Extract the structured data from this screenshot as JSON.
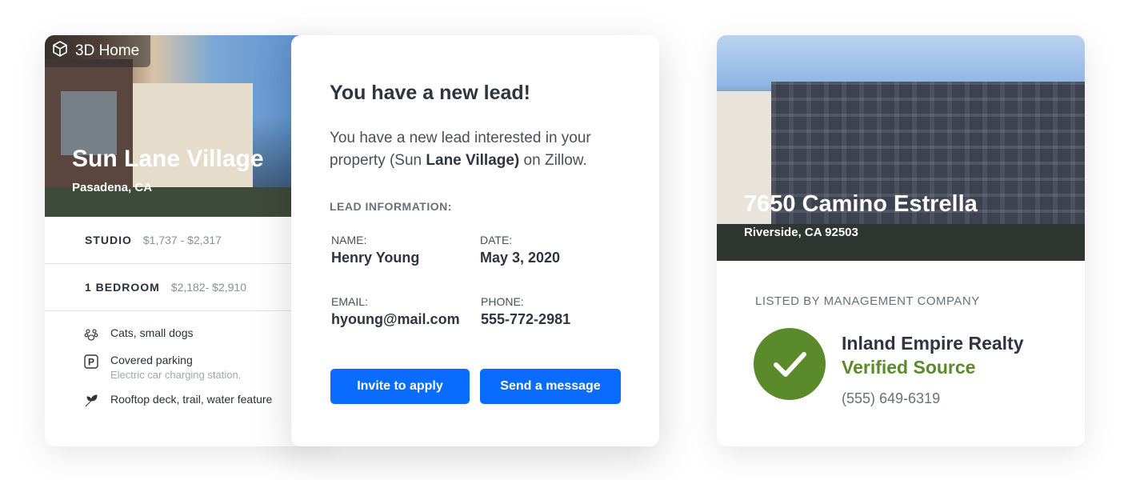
{
  "left_card": {
    "badge_label": "3D Home",
    "title": "Sun Lane Village",
    "city": "Pasadena, CA",
    "pricing": [
      {
        "label": "STUDIO",
        "value": "$1,737 - $2,317"
      },
      {
        "label": "1 BEDROOM",
        "value": "$2,182- $2,910"
      }
    ],
    "amenities": [
      {
        "icon": "paw-icon",
        "text": "Cats, small dogs",
        "sub": ""
      },
      {
        "icon": "parking-icon",
        "text": "Covered parking",
        "sub": "Electric car charging station."
      },
      {
        "icon": "leaf-icon",
        "text": "Rooftop deck, trail, water feature",
        "sub": ""
      }
    ]
  },
  "lead_card": {
    "title": "You have a new lead!",
    "body_prefix": "You have a new lead interested in your property (Sun ",
    "body_bold": "Lane Village)",
    "body_suffix": " on Zillow.",
    "section_title": "LEAD INFORMATION:",
    "name_label": "NAME:",
    "name_value": "Henry Young",
    "date_label": "DATE:",
    "date_value": "May 3, 2020",
    "email_label": "EMAIL:",
    "email_value": "hyoung@mail.com",
    "phone_label": "PHONE:",
    "phone_value": "555-772-2981",
    "invite_button": "Invite to apply",
    "message_button": "Send a message",
    "button_color": "#0a6cff"
  },
  "right_card": {
    "title": "7650 Camino Estrella",
    "city": "Riverside, CA 92503",
    "listed_by": "LISTED BY MANAGEMENT COMPANY",
    "company": "Inland Empire Realty",
    "verified": "Verified Source",
    "phone": "(555) 649-6319",
    "verified_color": "#5a8a2a"
  }
}
